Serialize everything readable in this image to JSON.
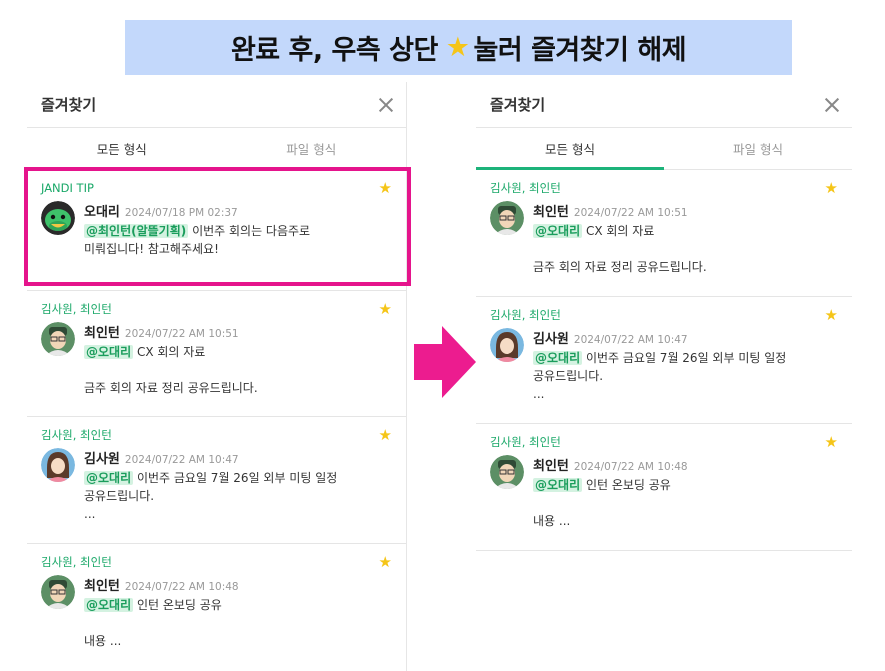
{
  "banner": {
    "text_before": "완료 후, 우측 상단",
    "text_after": "눌러 즐겨찾기 해제",
    "icon": "star-icon"
  },
  "colors": {
    "accent": "#1db37a",
    "mention_bg": "#d4f2e1",
    "star": "#f5c518",
    "highlight": "#e5148c",
    "banner_bg": "#c3d8fb"
  },
  "left_panel": {
    "title": "즐겨찾기",
    "tabs": [
      {
        "label": "모든 형식"
      },
      {
        "label": "파일 형식"
      }
    ],
    "items": [
      {
        "room": "JANDI TIP",
        "author": "오대리",
        "time": "2024/07/18 PM 02:37",
        "mention": "@최인턴(알뜰기획)",
        "text_inline": " 이번주 회의는 다음주로",
        "text_rest": "미뤄집니다! 참고해주세요!"
      },
      {
        "room": "김사원, 최인턴",
        "author": "최인턴",
        "time": "2024/07/22 AM 10:51",
        "mention": "@오대리",
        "text_inline": " CX 회의 자료",
        "text_rest": "\n금주 회의 자료 정리 공유드립니다."
      },
      {
        "room": "김사원, 최인턴",
        "author": "김사원",
        "time": "2024/07/22 AM 10:47",
        "mention": "@오대리",
        "text_inline": " 이번주 금요일 7월 26일 외부 미팅 일정",
        "text_rest": "공유드립니다.\n..."
      },
      {
        "room": "김사원, 최인턴",
        "author": "최인턴",
        "time": "2024/07/22 AM 10:48",
        "mention": "@오대리",
        "text_inline": " 인턴 온보딩 공유",
        "text_rest": "\n내용 ..."
      }
    ]
  },
  "right_panel": {
    "title": "즐겨찾기",
    "tabs": [
      {
        "label": "모든 형식"
      },
      {
        "label": "파일 형식"
      }
    ],
    "items": [
      {
        "room": "김사원, 최인턴",
        "author": "최인턴",
        "time": "2024/07/22 AM 10:51",
        "mention": "@오대리",
        "text_inline": " CX 회의 자료",
        "text_rest": "\n금주 회의 자료 정리 공유드립니다."
      },
      {
        "room": "김사원, 최인턴",
        "author": "김사원",
        "time": "2024/07/22 AM 10:47",
        "mention": "@오대리",
        "text_inline": " 이번주 금요일 7월 26일 외부 미팅 일정",
        "text_rest": "공유드립니다.\n..."
      },
      {
        "room": "김사원, 최인턴",
        "author": "최인턴",
        "time": "2024/07/22 AM 10:48",
        "mention": "@오대리",
        "text_inline": " 인턴 온보딩 공유",
        "text_rest": "\n내용 ..."
      }
    ]
  }
}
